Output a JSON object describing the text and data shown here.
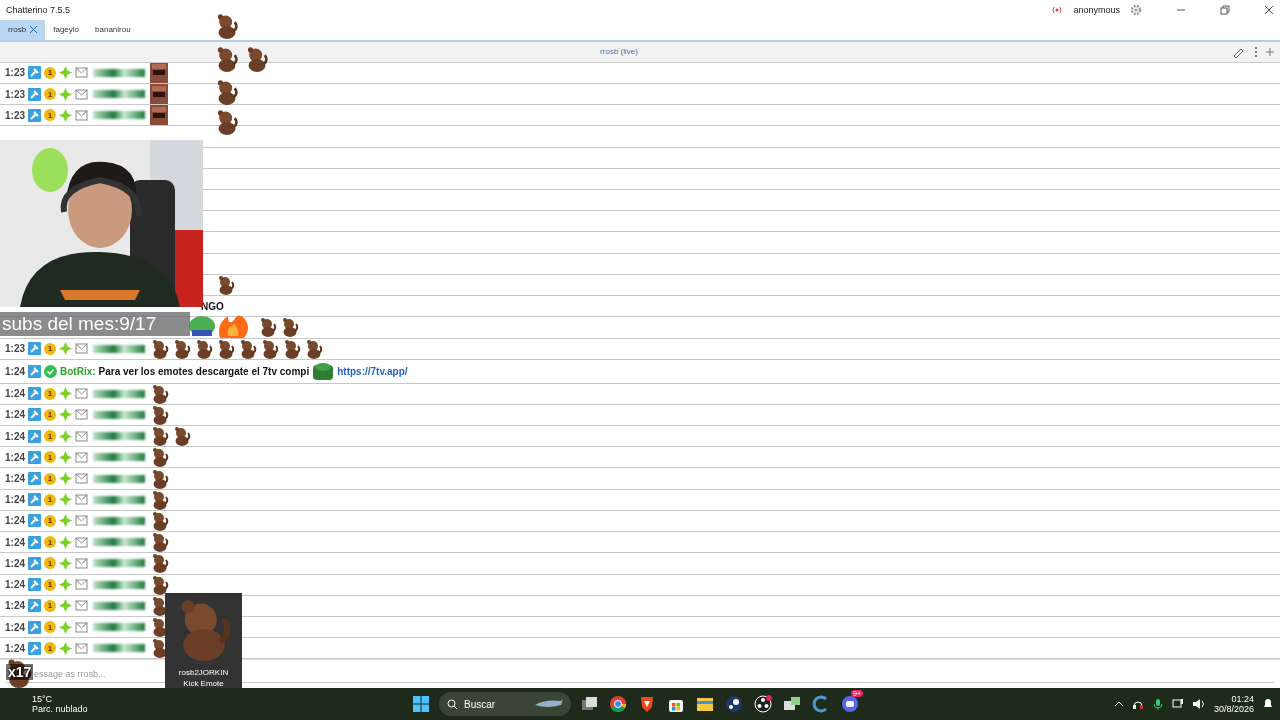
{
  "window": {
    "title": "Chatterino 7.5.5",
    "account": "anonymous"
  },
  "tabs": [
    {
      "label": "rrosb",
      "selected": true
    },
    {
      "label": "fageylo",
      "selected": false
    },
    {
      "label": "bananirou",
      "selected": false
    }
  ],
  "split": {
    "title": "rrosb (live)"
  },
  "rows": [
    {
      "kind": "chat",
      "time": "1:23",
      "badges": [
        {
          "kind": "mod"
        },
        {
          "kind": "coin",
          "label": "1"
        },
        {
          "kind": "spark"
        },
        {
          "kind": "mail"
        }
      ],
      "emotes": [
        {
          "kind": "face"
        }
      ]
    },
    {
      "kind": "chat",
      "time": "1:23",
      "badges": [
        {
          "kind": "mod"
        },
        {
          "kind": "coin",
          "label": "1"
        },
        {
          "kind": "spark"
        },
        {
          "kind": "mail"
        }
      ],
      "emotes": [
        {
          "kind": "face"
        }
      ]
    },
    {
      "kind": "chat",
      "time": "1:23",
      "badges": [
        {
          "kind": "mod"
        },
        {
          "kind": "coin",
          "label": "1"
        },
        {
          "kind": "spark"
        },
        {
          "kind": "mail"
        }
      ],
      "emotes": [
        {
          "kind": "face"
        }
      ]
    },
    {
      "kind": "covered"
    },
    {
      "kind": "covered"
    },
    {
      "kind": "covered"
    },
    {
      "kind": "covered"
    },
    {
      "kind": "covered"
    },
    {
      "kind": "covered"
    },
    {
      "kind": "covered"
    },
    {
      "kind": "tail_emotes",
      "emotes": [
        {
          "kind": "bear"
        }
      ]
    },
    {
      "kind": "tail_text",
      "text": "NGO"
    },
    {
      "kind": "tail_emotes",
      "emotes": [
        {
          "kind": "bear"
        },
        {
          "kind": "bear"
        }
      ]
    },
    {
      "kind": "chat",
      "time": "1:23",
      "badges": [
        {
          "kind": "mod"
        },
        {
          "kind": "coin",
          "label": "1"
        },
        {
          "kind": "spark"
        },
        {
          "kind": "mail"
        }
      ],
      "emotes": [
        {
          "kind": "bear"
        },
        {
          "kind": "bear"
        },
        {
          "kind": "bear"
        },
        {
          "kind": "bear"
        },
        {
          "kind": "bear"
        },
        {
          "kind": "bear"
        },
        {
          "kind": "bear"
        },
        {
          "kind": "bear"
        }
      ]
    },
    {
      "kind": "bot",
      "time": "1:24",
      "badges": [
        {
          "kind": "mod"
        },
        {
          "kind": "verified"
        }
      ],
      "user": "BotRix:",
      "text": "Para ver los emotes descargate el 7tv compi",
      "emotes": [
        {
          "kind": "frog"
        }
      ],
      "link": "https://7tv.app/"
    },
    {
      "kind": "chat",
      "time": "1:24",
      "badges": [
        {
          "kind": "mod"
        },
        {
          "kind": "coin",
          "label": "1"
        },
        {
          "kind": "spark"
        },
        {
          "kind": "mail"
        }
      ],
      "emotes": [
        {
          "kind": "bear"
        }
      ]
    },
    {
      "kind": "chat",
      "time": "1:24",
      "badges": [
        {
          "kind": "mod"
        },
        {
          "kind": "coin",
          "label": "1"
        },
        {
          "kind": "spark"
        },
        {
          "kind": "mail"
        }
      ],
      "emotes": [
        {
          "kind": "bear"
        }
      ]
    },
    {
      "kind": "chat",
      "time": "1:24",
      "badges": [
        {
          "kind": "mod"
        },
        {
          "kind": "coin",
          "label": "1"
        },
        {
          "kind": "spark"
        },
        {
          "kind": "mail"
        }
      ],
      "emotes": [
        {
          "kind": "bear"
        },
        {
          "kind": "bear"
        }
      ]
    },
    {
      "kind": "chat",
      "time": "1:24",
      "badges": [
        {
          "kind": "mod"
        },
        {
          "kind": "coin",
          "label": "1"
        },
        {
          "kind": "spark"
        },
        {
          "kind": "mail"
        }
      ],
      "emotes": [
        {
          "kind": "bear"
        }
      ]
    },
    {
      "kind": "chat",
      "time": "1:24",
      "badges": [
        {
          "kind": "mod"
        },
        {
          "kind": "coin",
          "label": "1"
        },
        {
          "kind": "spark"
        },
        {
          "kind": "mail"
        }
      ],
      "emotes": [
        {
          "kind": "bear"
        }
      ]
    },
    {
      "kind": "chat",
      "time": "1:24",
      "badges": [
        {
          "kind": "mod"
        },
        {
          "kind": "coin",
          "label": "1"
        },
        {
          "kind": "spark"
        },
        {
          "kind": "mail"
        }
      ],
      "emotes": [
        {
          "kind": "bear"
        }
      ]
    },
    {
      "kind": "chat",
      "time": "1:24",
      "badges": [
        {
          "kind": "mod"
        },
        {
          "kind": "coin",
          "label": "1"
        },
        {
          "kind": "spark"
        },
        {
          "kind": "mail"
        }
      ],
      "emotes": [
        {
          "kind": "bear"
        }
      ]
    },
    {
      "kind": "chat",
      "time": "1:24",
      "badges": [
        {
          "kind": "mod"
        },
        {
          "kind": "coin",
          "label": "1"
        },
        {
          "kind": "spark"
        },
        {
          "kind": "mail"
        }
      ],
      "emotes": [
        {
          "kind": "bear"
        }
      ]
    },
    {
      "kind": "chat",
      "time": "1:24",
      "badges": [
        {
          "kind": "mod"
        },
        {
          "kind": "coin",
          "label": "1"
        },
        {
          "kind": "spark"
        },
        {
          "kind": "mail"
        }
      ],
      "emotes": [
        {
          "kind": "bear"
        }
      ]
    },
    {
      "kind": "chat",
      "time": "1:24",
      "badges": [
        {
          "kind": "mod"
        },
        {
          "kind": "coin",
          "label": "1"
        },
        {
          "kind": "spark"
        },
        {
          "kind": "mail"
        }
      ],
      "emotes": [
        {
          "kind": "bear"
        }
      ]
    },
    {
      "kind": "chat",
      "time": "1:24",
      "badges": [
        {
          "kind": "mod"
        },
        {
          "kind": "coin",
          "label": "1"
        },
        {
          "kind": "spark"
        },
        {
          "kind": "mail"
        }
      ],
      "emotes": [
        {
          "kind": "bear"
        }
      ]
    },
    {
      "kind": "chat",
      "time": "1:24",
      "badges": [
        {
          "kind": "mod"
        },
        {
          "kind": "coin",
          "label": "1"
        },
        {
          "kind": "spark"
        },
        {
          "kind": "mail"
        }
      ],
      "emotes": [
        {
          "kind": "bear"
        }
      ]
    },
    {
      "kind": "chat",
      "time": "1:24",
      "badges": [
        {
          "kind": "mod"
        },
        {
          "kind": "coin",
          "label": "1"
        },
        {
          "kind": "spark"
        },
        {
          "kind": "mail"
        }
      ],
      "emotes": [
        {
          "kind": "bear"
        }
      ]
    }
  ],
  "input": {
    "placeholder": "essage as rrosb..."
  },
  "overlay": {
    "banner": "subs del mes:9/17",
    "counter": "x17"
  },
  "tooltip": {
    "name": "rosb2JORKIN",
    "type": "Kick Emote"
  },
  "taskbar": {
    "temperature": "15°C",
    "weather": "Parc. nublado",
    "search": "Buscar",
    "discord_badge": "9+",
    "time": "01:24",
    "date": "30/8/2026"
  }
}
